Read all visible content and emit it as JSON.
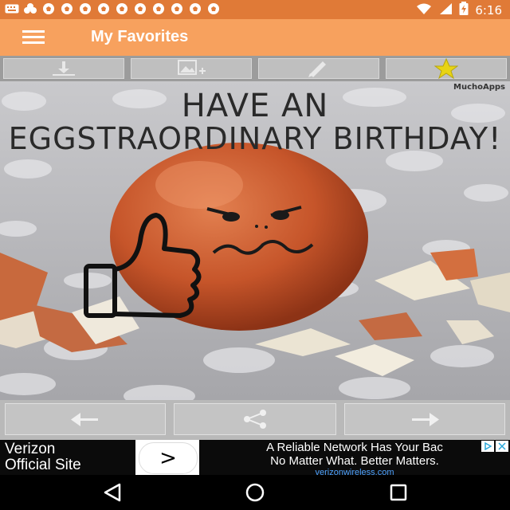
{
  "status_bar": {
    "time": "6:16",
    "notification_icons": [
      "keyboard-icon",
      "app-icon",
      "soccer-ball-icon",
      "soccer-ball-icon",
      "soccer-ball-icon",
      "soccer-ball-icon",
      "soccer-ball-icon",
      "soccer-ball-icon",
      "soccer-ball-icon",
      "soccer-ball-icon",
      "soccer-ball-icon",
      "soccer-ball-icon"
    ],
    "system_icons": [
      "wifi-icon",
      "signal-icon",
      "battery-icon"
    ]
  },
  "app_bar": {
    "title": "My Favorites",
    "background": "#f7a15e"
  },
  "toolbar": {
    "buttons": [
      {
        "name": "download-icon"
      },
      {
        "name": "add-image-icon"
      },
      {
        "name": "pencil-icon"
      },
      {
        "name": "star-icon",
        "color": "#e8d414"
      }
    ]
  },
  "card": {
    "watermark": "MuchoApps",
    "headline_line1": "HAVE AN",
    "headline_line2": "EGGSTRAORDINARY BIRTHDAY!"
  },
  "bottom_bar": {
    "buttons": [
      {
        "name": "arrow-left-icon"
      },
      {
        "name": "share-icon"
      },
      {
        "name": "arrow-right-icon"
      }
    ]
  },
  "ad": {
    "left_line1": "Verizon",
    "left_line2": "Official Site",
    "go_label": ">",
    "line1": "A Reliable Network Has Your Bac",
    "line2": "No Matter What. Better Matters.",
    "url": "verizonwireless.com"
  },
  "nav_bar": {
    "buttons": [
      "back-icon",
      "home-icon",
      "recents-icon"
    ]
  }
}
